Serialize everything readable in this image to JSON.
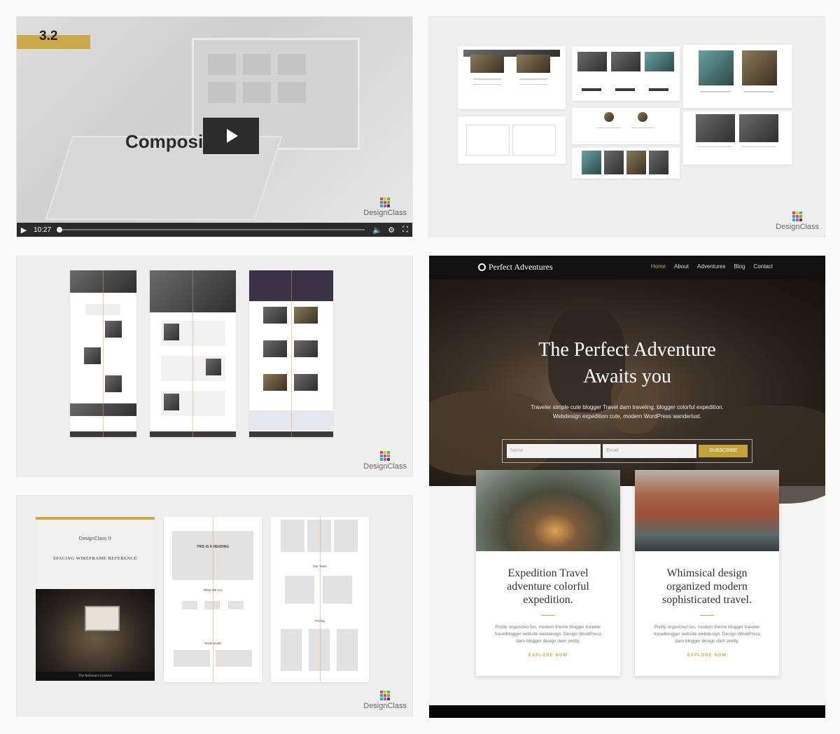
{
  "brand": {
    "name": "DesignClass",
    "colors": [
      "#e64b3c",
      "#f1c40f",
      "#2ecc71",
      "#3498db",
      "#9b59b6",
      "#e67e22",
      "#1abc9c",
      "#e84393",
      "#34495e"
    ]
  },
  "video": {
    "badge": "3.2",
    "title": "Composition",
    "time": "10:27",
    "progress": 0.0,
    "icons": {
      "play": "play-icon",
      "volume": "volume-icon",
      "settings": "gear-icon",
      "fullscreen": "fullscreen-icon"
    }
  },
  "wireframe": {
    "logo_text": "DesignClass ®",
    "heading": "SPACING WIREFRAME REFERENCE",
    "caption": "The Reference Creative",
    "mock_heading": "THIS IS A HEADING",
    "mock_what": "What We Are",
    "mock_testimonials": "Testimonials",
    "mock_team": "Our Team",
    "mock_pricing": "Pricing"
  },
  "site": {
    "logo": "Perfect Adventures",
    "nav": [
      "Home",
      "About",
      "Adventures",
      "Blog",
      "Contact"
    ],
    "nav_active": 0,
    "hero_title": "The Perfect Adventure Awaits you",
    "hero_sub": "Traveler simple cute blogger Travel darn traveling, blogger colorful expedition. Webdesign expedition cute, modern WordPress wanderlust.",
    "form": {
      "name_placeholder": "Name",
      "email_placeholder": "Email",
      "button": "SUBSCRIBE"
    },
    "cards": [
      {
        "title": "Expedition Travel adventure colorful expedition.",
        "text": "Pretty organized fun, modern theme blogger traveler travelblogger website webdesign. Design WordPress darn blogger design darn pretty.",
        "link": "EXPLORE NOW"
      },
      {
        "title": "Whimsical design organized modern sophisticated travel.",
        "text": "Pretty organized fun, modern theme blogger traveler travelblogger website webdesign. Design WordPress darn blogger design darn pretty.",
        "link": "EXPLORE NOW"
      }
    ],
    "accent": "#c9a94a"
  }
}
